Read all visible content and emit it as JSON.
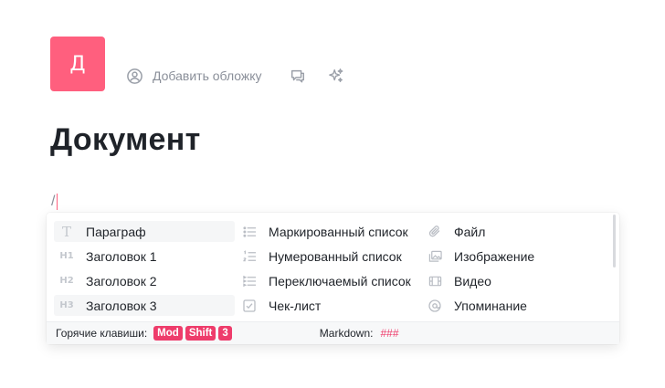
{
  "page": {
    "avatar_letter": "Д",
    "add_cover_label": "Добавить обложку",
    "title": "Документ",
    "editor_text": "/"
  },
  "menu": {
    "columns": [
      [
        {
          "label": "Параграф",
          "icon": "paragraph-icon",
          "glyph": "T",
          "active": true
        },
        {
          "label": "Заголовок 1",
          "icon": "heading-1-icon",
          "glyph": "H1"
        },
        {
          "label": "Заголовок 2",
          "icon": "heading-2-icon",
          "glyph": "H2"
        },
        {
          "label": "Заголовок 3",
          "icon": "heading-3-icon",
          "glyph": "H3",
          "active": true
        }
      ],
      [
        {
          "label": "Маркированный список",
          "icon": "bulleted-list-icon"
        },
        {
          "label": "Нумерованный список",
          "icon": "numbered-list-icon"
        },
        {
          "label": "Переключаемый список",
          "icon": "toggle-list-icon"
        },
        {
          "label": "Чек-лист",
          "icon": "checklist-icon"
        }
      ],
      [
        {
          "label": "Файл",
          "icon": "attachment-icon"
        },
        {
          "label": "Изображение",
          "icon": "image-icon"
        },
        {
          "label": "Видео",
          "icon": "video-icon"
        },
        {
          "label": "Упоминание",
          "icon": "mention-icon"
        }
      ]
    ],
    "footer": {
      "hotkeys_label": "Горячие клавиши:",
      "keys": [
        "Mod",
        "Shift",
        "3"
      ],
      "markdown_label": "Markdown:",
      "markdown_value": "###"
    }
  },
  "colors": {
    "accent": "#ff5f7e",
    "kbd": "#ee3c6b"
  }
}
